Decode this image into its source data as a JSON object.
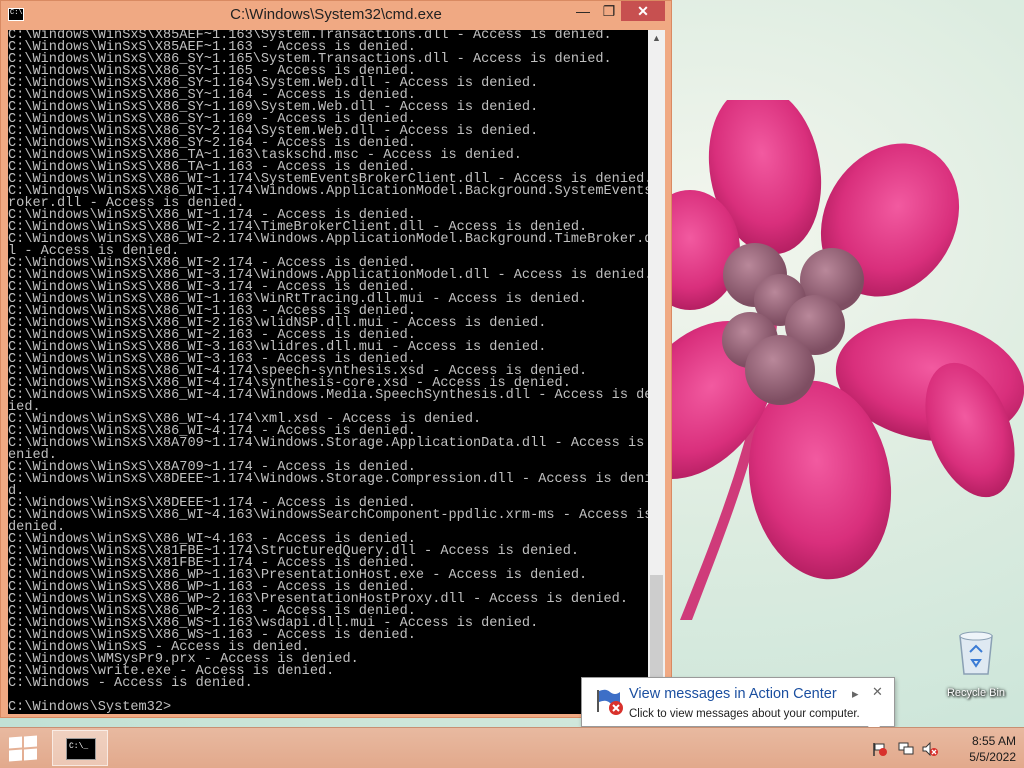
{
  "window": {
    "title": "C:\\Windows\\System32\\cmd.exe",
    "min_glyph": "—",
    "max_glyph": "❐",
    "close_glyph": "✕"
  },
  "console": {
    "lines": [
      "C:\\Windows\\WinSxS\\X85AEF~1.163\\System.Transactions.dll - Access is denied.",
      "C:\\Windows\\WinSxS\\X85AEF~1.163 - Access is denied.",
      "C:\\Windows\\WinSxS\\X86_SY~1.165\\System.Transactions.dll - Access is denied.",
      "C:\\Windows\\WinSxS\\X86_SY~1.165 - Access is denied.",
      "C:\\Windows\\WinSxS\\X86_SY~1.164\\System.Web.dll - Access is denied.",
      "C:\\Windows\\WinSxS\\X86_SY~1.164 - Access is denied.",
      "C:\\Windows\\WinSxS\\X86_SY~1.169\\System.Web.dll - Access is denied.",
      "C:\\Windows\\WinSxS\\X86_SY~1.169 - Access is denied.",
      "C:\\Windows\\WinSxS\\X86_SY~2.164\\System.Web.dll - Access is denied.",
      "C:\\Windows\\WinSxS\\X86_SY~2.164 - Access is denied.",
      "C:\\Windows\\WinSxS\\X86_TA~1.163\\taskschd.msc - Access is denied.",
      "C:\\Windows\\WinSxS\\X86_TA~1.163 - Access is denied.",
      "C:\\Windows\\WinSxS\\X86_WI~1.174\\SystemEventsBrokerClient.dll - Access is denied.",
      "C:\\Windows\\WinSxS\\X86_WI~1.174\\Windows.ApplicationModel.Background.SystemEventsB",
      "roker.dll - Access is denied.",
      "C:\\Windows\\WinSxS\\X86_WI~1.174 - Access is denied.",
      "C:\\Windows\\WinSxS\\X86_WI~2.174\\TimeBrokerClient.dll - Access is denied.",
      "C:\\Windows\\WinSxS\\X86_WI~2.174\\Windows.ApplicationModel.Background.TimeBroker.dl",
      "l - Access is denied.",
      "C:\\Windows\\WinSxS\\X86_WI~2.174 - Access is denied.",
      "C:\\Windows\\WinSxS\\X86_WI~3.174\\Windows.ApplicationModel.dll - Access is denied.",
      "C:\\Windows\\WinSxS\\X86_WI~3.174 - Access is denied.",
      "C:\\Windows\\WinSxS\\X86_WI~1.163\\WinRtTracing.dll.mui - Access is denied.",
      "C:\\Windows\\WinSxS\\X86_WI~1.163 - Access is denied.",
      "C:\\Windows\\WinSxS\\X86_WI~2.163\\wlidNSP.dll.mui - Access is denied.",
      "C:\\Windows\\WinSxS\\X86_WI~2.163 - Access is denied.",
      "C:\\Windows\\WinSxS\\X86_WI~3.163\\wlidres.dll.mui - Access is denied.",
      "C:\\Windows\\WinSxS\\X86_WI~3.163 - Access is denied.",
      "C:\\Windows\\WinSxS\\X86_WI~4.174\\speech-synthesis.xsd - Access is denied.",
      "C:\\Windows\\WinSxS\\X86_WI~4.174\\synthesis-core.xsd - Access is denied.",
      "C:\\Windows\\WinSxS\\X86_WI~4.174\\Windows.Media.SpeechSynthesis.dll - Access is den",
      "ied.",
      "C:\\Windows\\WinSxS\\X86_WI~4.174\\xml.xsd - Access is denied.",
      "C:\\Windows\\WinSxS\\X86_WI~4.174 - Access is denied.",
      "C:\\Windows\\WinSxS\\X8A709~1.174\\Windows.Storage.ApplicationData.dll - Access is d",
      "enied.",
      "C:\\Windows\\WinSxS\\X8A709~1.174 - Access is denied.",
      "C:\\Windows\\WinSxS\\X8DEEE~1.174\\Windows.Storage.Compression.dll - Access is denie",
      "d.",
      "C:\\Windows\\WinSxS\\X8DEEE~1.174 - Access is denied.",
      "C:\\Windows\\WinSxS\\X86_WI~4.163\\WindowsSearchComponent-ppdlic.xrm-ms - Access is",
      "denied.",
      "C:\\Windows\\WinSxS\\X86_WI~4.163 - Access is denied.",
      "C:\\Windows\\WinSxS\\X81FBE~1.174\\StructuredQuery.dll - Access is denied.",
      "C:\\Windows\\WinSxS\\X81FBE~1.174 - Access is denied.",
      "C:\\Windows\\WinSxS\\X86_WP~1.163\\PresentationHost.exe - Access is denied.",
      "C:\\Windows\\WinSxS\\X86_WP~1.163 - Access is denied.",
      "C:\\Windows\\WinSxS\\X86_WP~2.163\\PresentationHostProxy.dll - Access is denied.",
      "C:\\Windows\\WinSxS\\X86_WP~2.163 - Access is denied.",
      "C:\\Windows\\WinSxS\\X86_WS~1.163\\wsdapi.dll.mui - Access is denied.",
      "C:\\Windows\\WinSxS\\X86_WS~1.163 - Access is denied.",
      "C:\\Windows\\WinSxS - Access is denied.",
      "C:\\Windows\\WMSysPr9.prx - Access is denied.",
      "C:\\Windows\\write.exe - Access is denied.",
      "C:\\Windows - Access is denied.",
      "",
      "C:\\Windows\\System32>"
    ]
  },
  "desktop": {
    "recycle_bin_label": "Recycle Bin"
  },
  "notification": {
    "title": "View messages in Action Center",
    "text": "Click to view messages about your computer.",
    "options_glyph": "▸",
    "close_glyph": "✕"
  },
  "taskbar": {
    "time": "8:55 AM",
    "date": "5/5/2022"
  },
  "colors": {
    "window_frame": "#f0a983",
    "close_button": "#c75050",
    "console_bg": "#000000",
    "console_text": "#c0c0c0",
    "notification_title": "#1b4fa0"
  }
}
